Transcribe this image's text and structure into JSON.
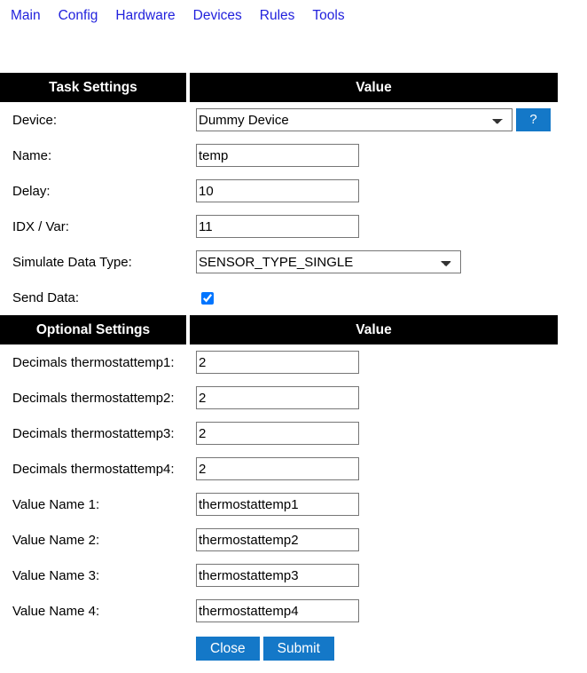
{
  "nav": {
    "items": [
      {
        "label": "Main"
      },
      {
        "label": "Config"
      },
      {
        "label": "Hardware"
      },
      {
        "label": "Devices"
      },
      {
        "label": "Rules"
      },
      {
        "label": "Tools"
      }
    ],
    "link_color": "#2222dd"
  },
  "task_section": {
    "header_label": "Task Settings",
    "header_value": "Value",
    "device": {
      "label": "Device:",
      "value": "Dummy Device",
      "options": [
        "Dummy Device"
      ],
      "help_label": "?"
    },
    "name": {
      "label": "Name:",
      "value": "temp",
      "placeholder": ""
    },
    "delay": {
      "label": "Delay:",
      "value": "10",
      "placeholder": ""
    },
    "idx_var": {
      "label": "IDX / Var:",
      "value": "11",
      "placeholder": ""
    },
    "simulate_data_type": {
      "label": "Simulate Data Type:",
      "value": "SENSOR_TYPE_SINGLE",
      "options": [
        "SENSOR_TYPE_SINGLE"
      ]
    },
    "send_data": {
      "label": "Send Data:",
      "checked": true
    }
  },
  "optional_section": {
    "header_label": "Optional Settings",
    "header_value": "Value",
    "decimals": [
      {
        "label": "Decimals thermostattemp1:",
        "value": "2"
      },
      {
        "label": "Decimals thermostattemp2:",
        "value": "2"
      },
      {
        "label": "Decimals thermostattemp3:",
        "value": "2"
      },
      {
        "label": "Decimals thermostattemp4:",
        "value": "2"
      }
    ],
    "value_names": [
      {
        "label": "Value Name 1:",
        "value": "thermostattemp1"
      },
      {
        "label": "Value Name 2:",
        "value": "thermostattemp2"
      },
      {
        "label": "Value Name 3:",
        "value": "thermostattemp3"
      },
      {
        "label": "Value Name 4:",
        "value": "thermostattemp4"
      }
    ]
  },
  "footer": {
    "close_label": "Close",
    "submit_label": "Submit",
    "button_color": "#1478c8"
  }
}
